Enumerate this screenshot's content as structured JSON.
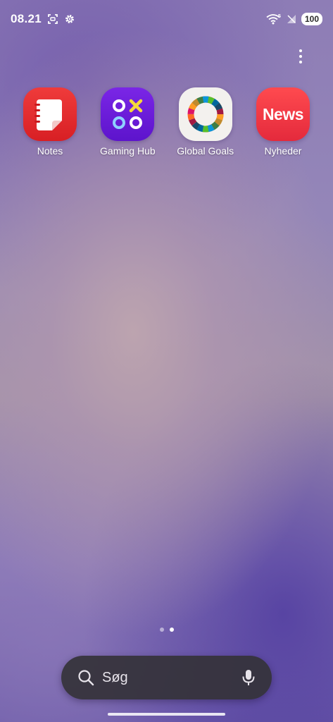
{
  "status_bar": {
    "time": "08.21",
    "icons": [
      "screenshot-icon",
      "settings-gear-icon",
      "wifi-icon",
      "no-signal-icon"
    ],
    "battery": "100"
  },
  "home": {
    "apps": [
      {
        "label": "Notes",
        "icon": "notes-icon",
        "color": "#e32b2e"
      },
      {
        "label": "Gaming Hub",
        "icon": "gaming-hub-icon",
        "color": "#6a1cd9"
      },
      {
        "label": "Global Goals",
        "icon": "global-goals-icon",
        "color": "#f3f1ee"
      },
      {
        "label": "Nyheder",
        "icon": "news-icon",
        "color": "#ee3344",
        "icon_text": "News"
      }
    ],
    "page_indicator": {
      "pages": 2,
      "current": 2
    }
  },
  "search": {
    "placeholder": "Søg",
    "icons": [
      "search-icon",
      "microphone-icon"
    ]
  }
}
